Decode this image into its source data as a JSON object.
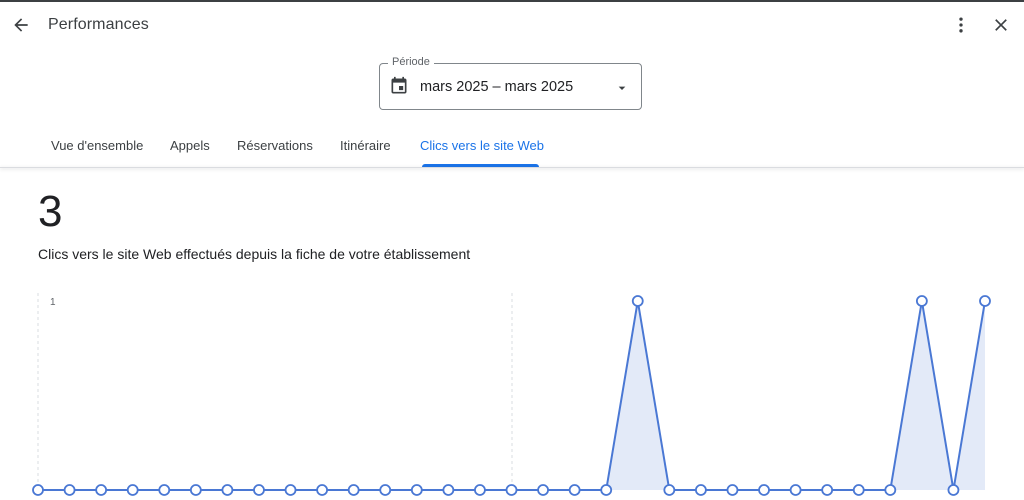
{
  "header": {
    "title": "Performances",
    "back_icon": "arrow-back-icon",
    "more_icon": "more-vert-icon",
    "close_icon": "close-icon"
  },
  "period": {
    "legend": "Période",
    "value": "mars 2025 – mars 2025",
    "calendar_icon": "calendar-icon",
    "dropdown_icon": "dropdown-arrow-icon"
  },
  "tabs": [
    {
      "label": "Vue d'ensemble",
      "active": false
    },
    {
      "label": "Appels",
      "active": false
    },
    {
      "label": "Réservations",
      "active": false
    },
    {
      "label": "Itinéraire",
      "active": false
    },
    {
      "label": "Clics vers le site Web",
      "active": true
    }
  ],
  "summary": {
    "total": "3",
    "description": "Clics vers le site Web effectués depuis la fiche de votre établissement"
  },
  "colors": {
    "accent": "#1a73e8",
    "series_line": "#4a78d4",
    "series_fill": "#e3eaf8"
  },
  "chart_data": {
    "type": "area",
    "y_tick_labels": [
      "1"
    ],
    "ylim": [
      0,
      1
    ],
    "grid": "dashed vertical lines",
    "series": [
      {
        "values": [
          0,
          0,
          0,
          0,
          0,
          0,
          0,
          0,
          0,
          0,
          0,
          0,
          0,
          0,
          0,
          0,
          0,
          0,
          0,
          1,
          0,
          0,
          0,
          0,
          0,
          0,
          0,
          0,
          1,
          0,
          1
        ]
      }
    ]
  }
}
